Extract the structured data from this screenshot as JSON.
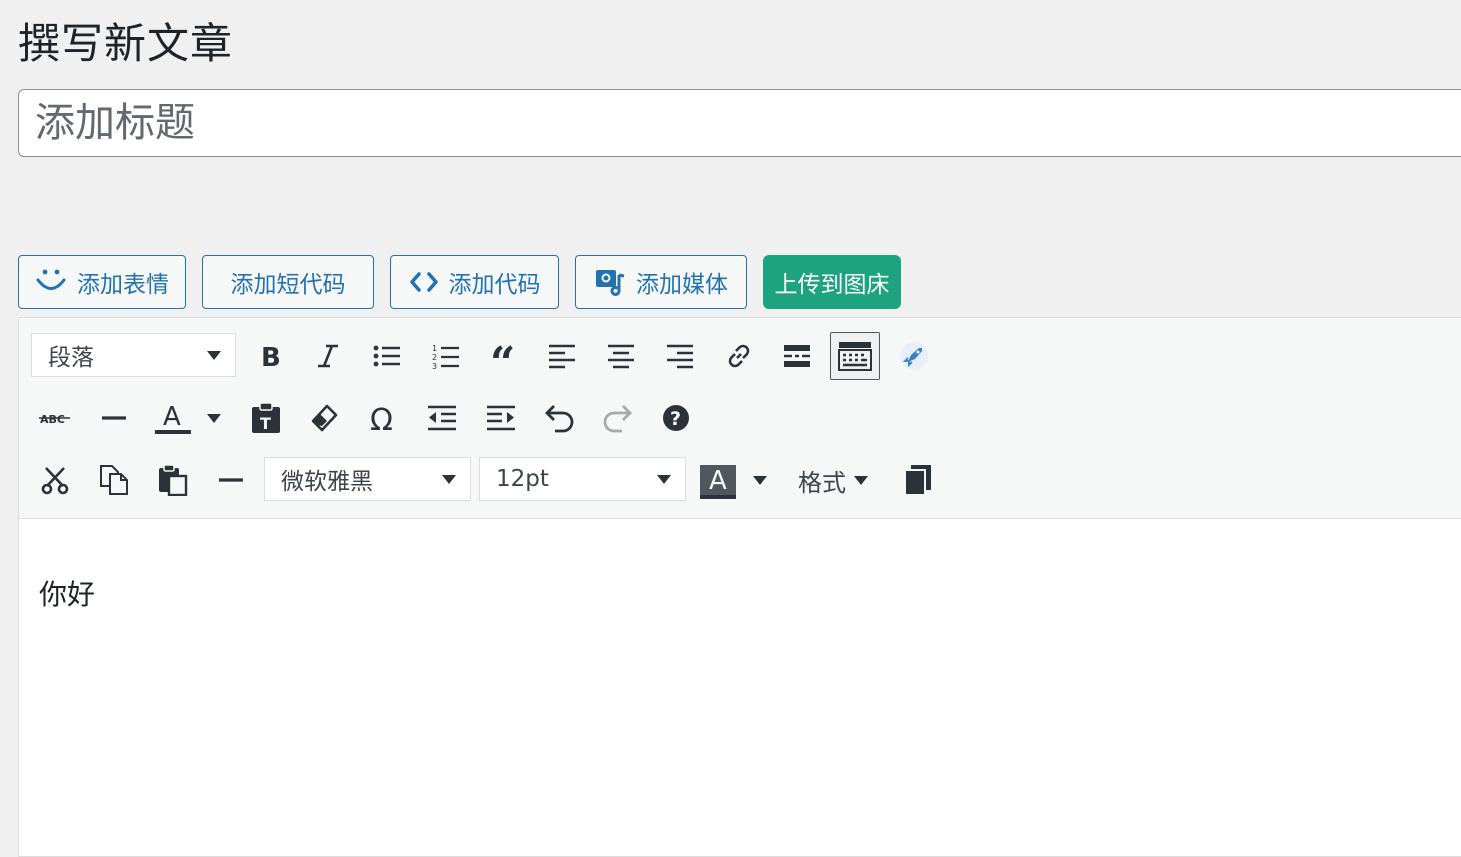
{
  "page": {
    "title": "撰写新文章"
  },
  "title_field": {
    "placeholder": "添加标题",
    "value": ""
  },
  "media_buttons": {
    "emoji": "添加表情",
    "shortcode": "添加短代码",
    "code": "添加代码",
    "media": "添加媒体",
    "upload": "上传到图床"
  },
  "toolbar": {
    "format_select": "段落",
    "font_family": "微软雅黑",
    "font_size": "12pt",
    "formats_menu": "格式",
    "icons_row1": [
      "bold-icon",
      "italic-icon",
      "bulleted-list-icon",
      "numbered-list-icon",
      "blockquote-icon",
      "align-left-icon",
      "align-center-icon",
      "align-right-icon",
      "link-icon",
      "read-more-icon",
      "toolbar-toggle-icon",
      "rocket-icon"
    ],
    "icons_row2": [
      "strikethrough-icon",
      "horizontal-line-icon",
      "text-color-icon",
      "paste-as-text-icon",
      "clear-formatting-icon",
      "special-character-icon",
      "outdent-icon",
      "indent-icon",
      "undo-icon",
      "redo-icon",
      "help-icon"
    ],
    "icons_row3": [
      "cut-icon",
      "copy-icon",
      "paste-icon",
      "separator-icon",
      "background-color-icon",
      "copy-doc-icon"
    ]
  },
  "editor": {
    "content": "你好"
  },
  "colors": {
    "accent": "#2271b1",
    "upload_button": "#1ea37f",
    "rocket": "#3582c4"
  }
}
